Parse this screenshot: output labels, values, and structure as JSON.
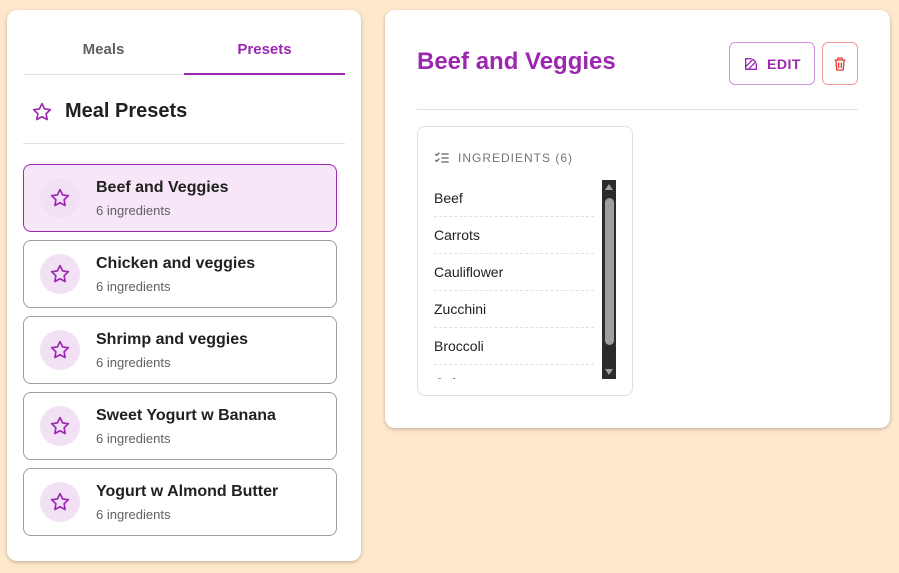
{
  "tabs": [
    {
      "label": "Meals",
      "active": false
    },
    {
      "label": "Presets",
      "active": true
    }
  ],
  "presets_header": {
    "title": "Meal Presets",
    "icon": "star-outline-icon"
  },
  "presets": [
    {
      "name": "Beef and Veggies",
      "count": "6 ingredients",
      "selected": true
    },
    {
      "name": "Chicken and veggies",
      "count": "6 ingredients",
      "selected": false
    },
    {
      "name": "Shrimp and veggies",
      "count": "6 ingredients",
      "selected": false
    },
    {
      "name": "Sweet Yogurt w Banana",
      "count": "6 ingredients",
      "selected": false
    },
    {
      "name": "Yogurt w Almond Butter",
      "count": "6 ingredients",
      "selected": false
    }
  ],
  "detail": {
    "title": "Beef and Veggies",
    "edit_label": "EDIT",
    "ingredients_header": "INGREDIENTS (6)",
    "ingredients": [
      "Beef",
      "Carrots",
      "Cauliflower",
      "Zucchini",
      "Broccoli",
      "Onion"
    ]
  },
  "colors": {
    "accent": "#9c27b0",
    "background": "#ffe8cc",
    "selected_bg": "#f6e6f8",
    "danger": "#e53935"
  }
}
